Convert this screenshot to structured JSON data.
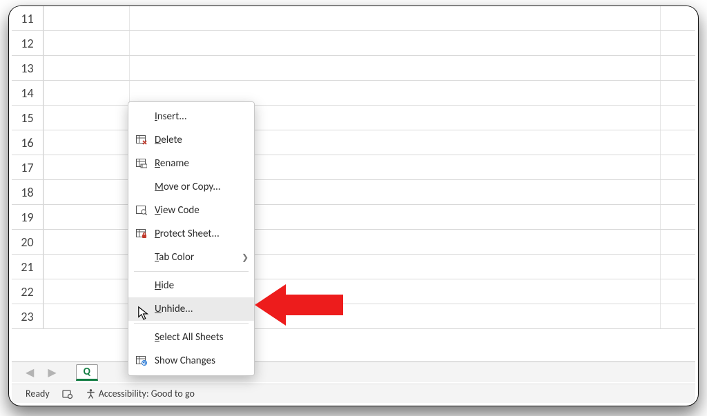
{
  "rows": [
    "11",
    "12",
    "13",
    "14",
    "15",
    "16",
    "17",
    "18",
    "19",
    "20",
    "21",
    "22",
    "23"
  ],
  "tabs": {
    "active_label": "Q"
  },
  "status": {
    "ready": "Ready",
    "accessibility": "Accessibility: Good to go"
  },
  "menu": {
    "insert": "Insert...",
    "delete": "Delete",
    "rename": "Rename",
    "move_copy": "Move or Copy...",
    "view_code": "View Code",
    "protect_sheet": "Protect Sheet...",
    "tab_color": "Tab Color",
    "hide": "Hide",
    "unhide": "Unhide...",
    "select_all": "Select All Sheets",
    "show_changes": "Show Changes"
  }
}
